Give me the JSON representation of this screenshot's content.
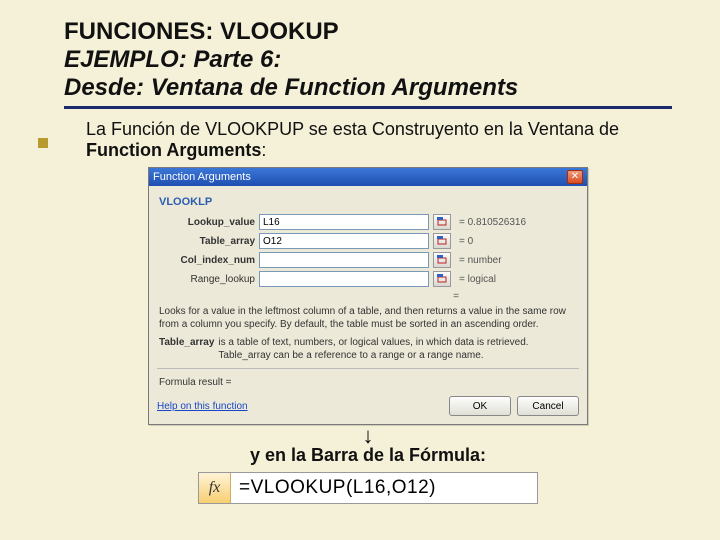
{
  "slide": {
    "title1": "FUNCIONES: VLOOKUP",
    "title2": "EJEMPLO: Parte 6:",
    "title3_a": "Desde: Ventana de ",
    "title3_b": "Function Arguments",
    "body_a": "La Función de VLOOKPUP se esta Construyento en la Ventana de ",
    "body_b": "Function Arguments",
    "body_c": ":",
    "caption": "y en la Barra de la Fórmula:",
    "arrow": "↓"
  },
  "dialog": {
    "title": "Function Arguments",
    "close": "✕",
    "func_name": "VLOOKLP",
    "args": [
      {
        "label": "Lookup_value",
        "bold": true,
        "value": "L16",
        "result": "= 0.810526316"
      },
      {
        "label": "Table_array",
        "bold": true,
        "value": "O12",
        "result": "= 0"
      },
      {
        "label": "Col_index_num",
        "bold": true,
        "value": "",
        "result": "= number"
      },
      {
        "label": "Range_lookup",
        "bold": false,
        "value": "",
        "result": "= logical"
      }
    ],
    "eq": "=",
    "desc": "Looks for a value in the leftmost column of a table, and then returns a value in the same row from a column you specify. By default, the table must be sorted in an ascending order.",
    "desc2_label": "Table_array",
    "desc2_text": "is a table of text, numbers, or logical values, in which data is retrieved. Table_array can be a reference to a range or a range name.",
    "formula_result_label": "Formula result =",
    "help": "Help on this function",
    "ok": "OK",
    "cancel": "Cancel"
  },
  "formula_bar": {
    "fx": "fx",
    "text": "=VLOOKUP(L16,O12)"
  }
}
